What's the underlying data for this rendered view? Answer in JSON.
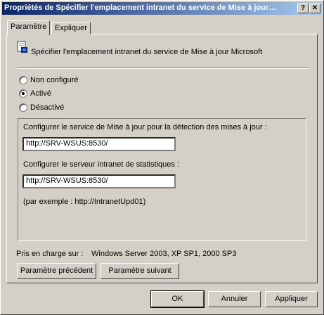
{
  "window": {
    "title": "Propriétés de Spécifier l'emplacement intranet du service de Mise à jour…",
    "help_button": "?",
    "close_button": "✕"
  },
  "tabs": [
    {
      "label": "Paramètre",
      "active": true
    },
    {
      "label": "Expliquer",
      "active": false
    }
  ],
  "policy": {
    "icon": "policy-setting-icon",
    "heading": "Spécifier l'emplacement intranet du service de Mise à jour Microsoft"
  },
  "radios": [
    {
      "label": "Non configuré",
      "checked": false
    },
    {
      "label": "Activé",
      "checked": true
    },
    {
      "label": "Désactivé",
      "checked": false
    }
  ],
  "options": {
    "update_service_label": "Configurer le service de Mise à jour pour la détection des mises à jour :",
    "update_service_value": "http://SRV-WSUS:8530/",
    "stats_server_label": "Configurer le serveur intranet de statistiques :",
    "stats_server_value": "http://SRV-WSUS:8530/",
    "example": "(par exemple : http://IntranetUpd01)"
  },
  "supported": {
    "label": "Pris en charge sur :",
    "value": "Windows Server 2003, XP SP1, 2000 SP3"
  },
  "nav": {
    "previous": "Paramètre précédent",
    "next": "Paramètre suivant"
  },
  "buttons": {
    "ok": "OK",
    "cancel": "Annuler",
    "apply": "Appliquer"
  }
}
